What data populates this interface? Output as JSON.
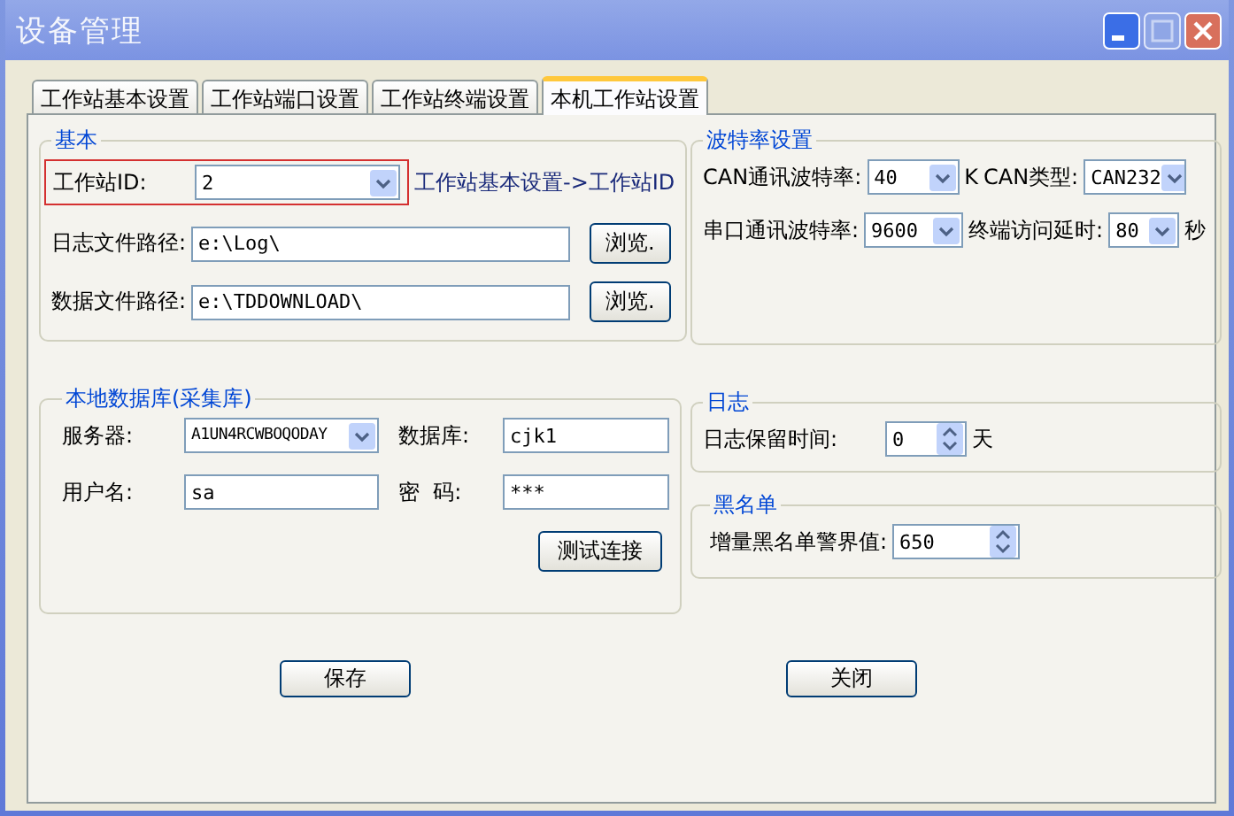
{
  "window": {
    "title": "设备管理"
  },
  "tabs": [
    {
      "label": "工作站基本设置",
      "selected": false
    },
    {
      "label": "工作站端口设置",
      "selected": false
    },
    {
      "label": "工作站终端设置",
      "selected": false
    },
    {
      "label": "本机工作站设置",
      "selected": true
    }
  ],
  "basic": {
    "legend": "基本",
    "station_id": {
      "label": "工作站ID:",
      "value": "2",
      "highlighted": true,
      "hint": "工作站基本设置->工作站ID"
    },
    "paths": [
      {
        "label": "日志文件路径:",
        "value": "e:\\Log\\",
        "button": "浏览."
      },
      {
        "label": "数据文件路径:",
        "value": "e:\\TDDOWNLOAD\\",
        "button": "浏览."
      }
    ]
  },
  "baud": {
    "legend": "波特率设置",
    "can_rate": {
      "label": "CAN通讯波特率:",
      "value": "40",
      "unit": "K"
    },
    "can_type": {
      "label": "CAN类型:",
      "value": "CAN232"
    },
    "serial_rate": {
      "label": "串口通讯波特率:",
      "value": "9600"
    },
    "terminal_delay": {
      "label": "终端访问延时:",
      "value": "80",
      "unit": "秒"
    }
  },
  "database": {
    "legend": "本地数据库(采集库)",
    "server": {
      "label": "服务器:",
      "value": "A1UN4RCWBOQODAY"
    },
    "database": {
      "label": "数据库:",
      "value": "cjk1"
    },
    "username": {
      "label": "用户名:",
      "value": "sa"
    },
    "password": {
      "label": "密  码:",
      "value": "***"
    },
    "test_button": "测试连接"
  },
  "log": {
    "legend": "日志",
    "retention": {
      "label": "日志保留时间:",
      "value": "0",
      "unit": "天"
    }
  },
  "blacklist": {
    "legend": "黑名单",
    "threshold": {
      "label": "增量黑名单警界值:",
      "value": "650"
    }
  },
  "buttons": [
    "保存",
    "关闭"
  ]
}
